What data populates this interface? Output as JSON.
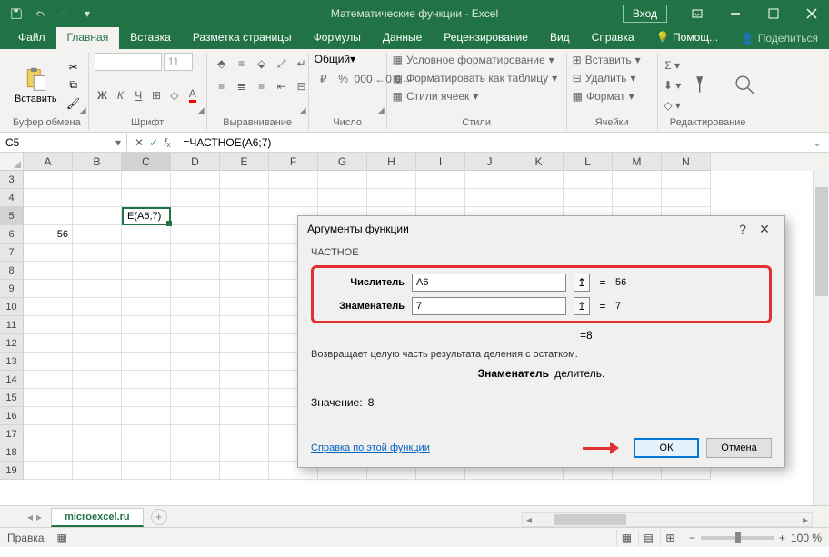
{
  "title": "Математические функции  -  Excel",
  "signin": "Вход",
  "tabs": [
    "Файл",
    "Главная",
    "Вставка",
    "Разметка страницы",
    "Формулы",
    "Данные",
    "Рецензирование",
    "Вид",
    "Справка",
    "Помощ...",
    "Поделиться"
  ],
  "activeTab": 1,
  "ribbon": {
    "paste": "Вставить",
    "groups": [
      "Буфер обмена",
      "Шрифт",
      "Выравнивание",
      "Число",
      "Стили",
      "Ячейки",
      "Редактирование"
    ],
    "numberFormat": "Общий",
    "fontSize": "11",
    "styles": {
      "cond": "Условное форматирование",
      "table": "Форматировать как таблицу",
      "cell": "Стили ячеек"
    },
    "cells": {
      "insert": "Вставить",
      "delete": "Удалить",
      "format": "Формат"
    }
  },
  "namebox": "C5",
  "formula": "=ЧАСТНОЕ(A6;7)",
  "cols": [
    "A",
    "B",
    "C",
    "D",
    "E",
    "F",
    "G",
    "H",
    "I",
    "J",
    "K",
    "L",
    "M",
    "N"
  ],
  "rows": [
    "3",
    "4",
    "5",
    "6",
    "7",
    "8",
    "9",
    "10",
    "11",
    "12",
    "13",
    "14",
    "15",
    "16",
    "17",
    "18",
    "19"
  ],
  "cells": {
    "C5": "Е(A6;7)",
    "A6": "56"
  },
  "dialog": {
    "title": "Аргументы функции",
    "func": "ЧАСТНОЕ",
    "args": [
      {
        "label": "Числитель",
        "value": "A6",
        "result": "56"
      },
      {
        "label": "Знаменатель",
        "value": "7",
        "result": "7"
      }
    ],
    "computed": "8",
    "desc": "Возвращает целую часть результата деления с остатком.",
    "paramName": "Знаменатель",
    "paramDesc": "делитель.",
    "valueLabel": "Значение:",
    "valueResult": "8",
    "helpLink": "Справка по этой функции",
    "ok": "ОК",
    "cancel": "Отмена"
  },
  "sheet": "microexcel.ru",
  "status": "Правка",
  "zoom": "100 %"
}
